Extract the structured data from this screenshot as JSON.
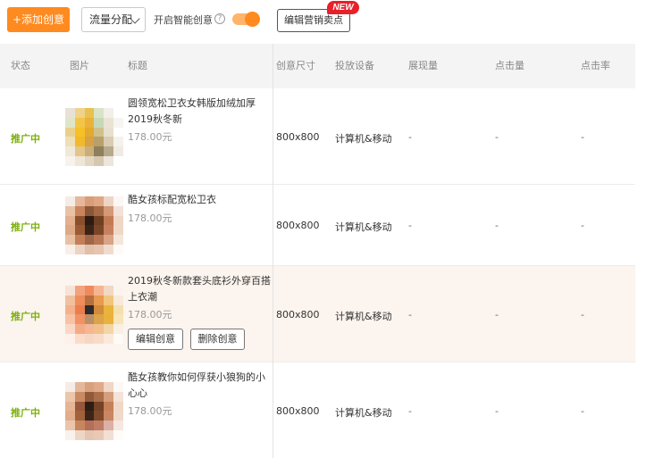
{
  "toolbar": {
    "add_label": "+添加创意",
    "flow_label": "流量分配",
    "smart_label": "开启智能创意",
    "help_glyph": "?",
    "edit_selling_label": "编辑营销卖点",
    "new_badge": "NEW",
    "smart_enabled": true
  },
  "table": {
    "headers": {
      "status": "状态",
      "image": "图片",
      "title": "标题",
      "size": "创意尺寸",
      "device": "投放设备",
      "impressions": "展现量",
      "clicks": "点击量",
      "ctr": "点击率"
    },
    "rows": [
      {
        "status": "推广中",
        "title": "圆领宽松卫衣女韩版加绒加厚2019秋冬新",
        "price": "178.00元",
        "size": "800x800",
        "device": "计算机&移动",
        "impressions": "-",
        "clicks": "-",
        "ctr": "-"
      },
      {
        "status": "推广中",
        "title": "酷女孩标配宽松卫衣",
        "price": "178.00元",
        "size": "800x800",
        "device": "计算机&移动",
        "impressions": "-",
        "clicks": "-",
        "ctr": "-"
      },
      {
        "status": "推广中",
        "title": "2019秋冬新款套头底衫外穿百搭上衣潮",
        "price": "178.00元",
        "size": "800x800",
        "device": "计算机&移动",
        "impressions": "-",
        "clicks": "-",
        "ctr": "-",
        "edit_label": "编辑创意",
        "delete_label": "删除创意"
      },
      {
        "status": "推广中",
        "title": "酷女孩教你如何俘获小狼狗的小心心",
        "price": "178.00元",
        "size": "800x800",
        "device": "计算机&移动",
        "impressions": "-",
        "clicks": "-",
        "ctr": "-"
      }
    ]
  },
  "colors": {
    "accent_orange": "#ff8a1f",
    "status_green": "#7cb00c",
    "new_badge_red": "#e8202a",
    "highlight_row": "#fcf4ee",
    "header_bg": "#f4f4f4"
  },
  "icons": [
    "help-icon",
    "chevron-down-icon"
  ]
}
